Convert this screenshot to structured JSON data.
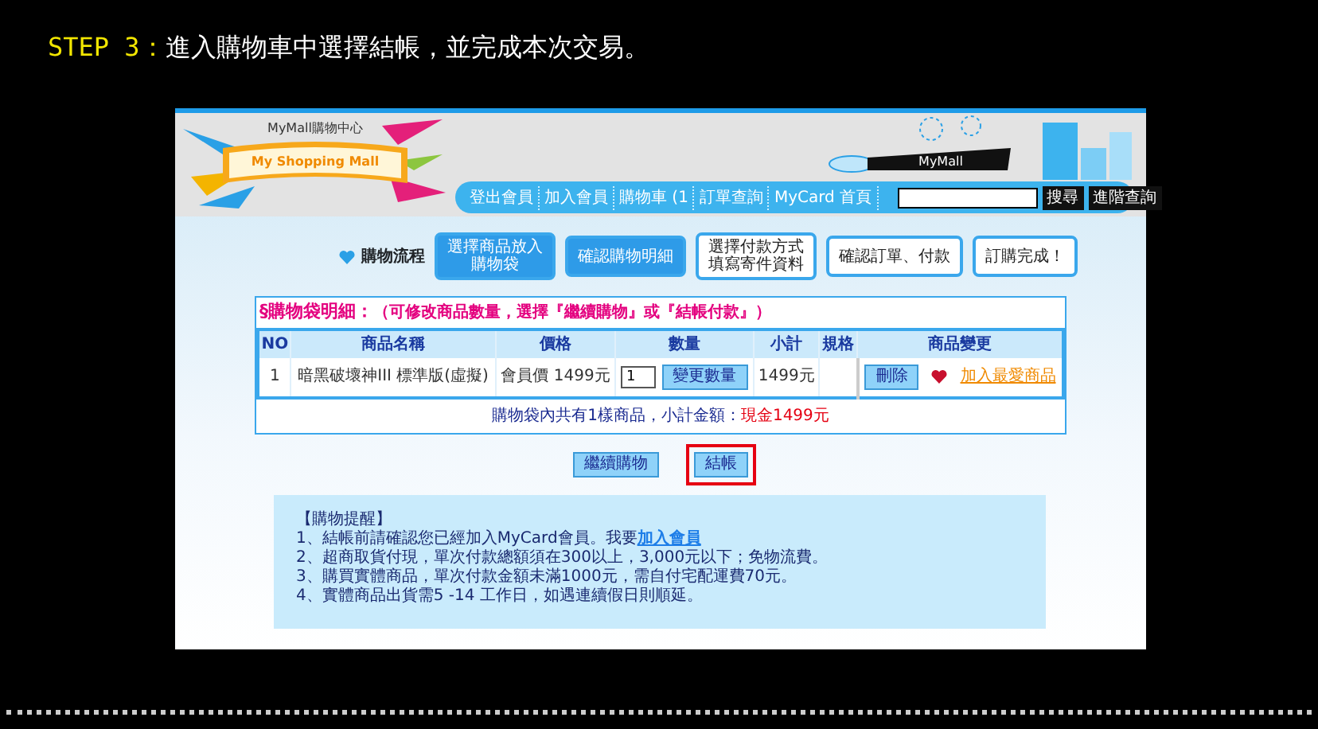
{
  "step": {
    "label": "STEP 3：",
    "text": "進入購物車中選擇結帳，並完成本次交易。"
  },
  "logo": {
    "top": "MyMall購物中心",
    "banner": "My Shopping Mall"
  },
  "decoration": {
    "banner": "MyMall"
  },
  "nav": [
    "登出會員",
    "加入會員",
    "購物車 (1",
    "訂單查詢",
    "MyCard 首頁"
  ],
  "search": {
    "buttons": [
      "搜尋",
      "進階查詢"
    ]
  },
  "flow": {
    "title": "購物流程",
    "steps": [
      {
        "lines": [
          "選擇商品放入",
          "購物袋"
        ],
        "selected": true
      },
      {
        "lines": [
          "確認購物明細"
        ],
        "selected": true
      },
      {
        "lines": [
          "選擇付款方式",
          "填寫寄件資料"
        ],
        "selected": false
      },
      {
        "lines": [
          "確認訂單、付款"
        ],
        "selected": false
      },
      {
        "lines": [
          "訂購完成！"
        ],
        "selected": false
      }
    ]
  },
  "cart": {
    "title": "§購物袋明細：",
    "hint": "（可修改商品數量，選擇『繼續購物』或『結帳付款』）",
    "columns": [
      "NO",
      "商品名稱",
      "價格",
      "數量",
      "小計",
      "規格",
      "商品變更"
    ],
    "rows": [
      {
        "no": "1",
        "name": "暗黑破壞神III 標準版(虛擬)",
        "price": "會員價 1499元",
        "qty": "1",
        "qty_button": "變更數量",
        "subtotal": "1499元",
        "delete": "刪除",
        "wish": "加入最愛商品"
      }
    ],
    "summary": "購物袋內共有1樣商品，小計金額：",
    "amount": "現金1499元"
  },
  "actions": [
    {
      "label": "繼續購物",
      "highlighted": false
    },
    {
      "label": "結帳",
      "highlighted": true
    }
  ],
  "notes": {
    "title": "【購物提醒】",
    "items": [
      {
        "text": "1、結帳前請確認您已經加入MyCard會員。我要",
        "link": "加入會員"
      },
      {
        "text": "2、超商取貨付現，單次付款總額須在300以上，3,000元以下；免物流費。"
      },
      {
        "text": "3、購買實體商品，單次付款金額未滿1000元，需自付宅配運費70元。"
      },
      {
        "text": "4、實體商品出貨需5 -14 工作日，如遇連續假日則順延。"
      }
    ]
  }
}
